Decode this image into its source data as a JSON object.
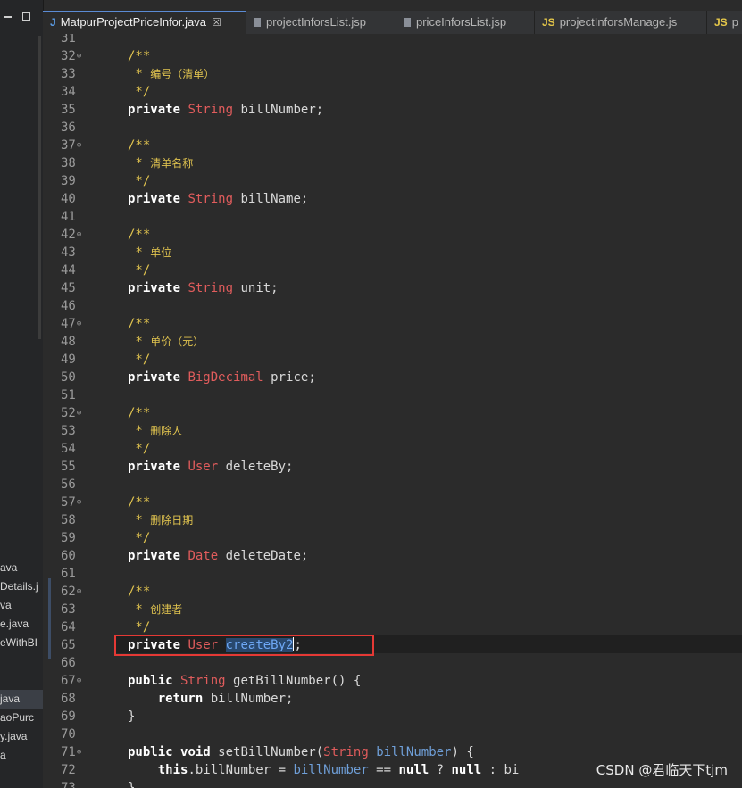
{
  "tabs": [
    {
      "label": "MatpurProjectPriceInfor.java",
      "icon": "java-file-icon",
      "active": true,
      "closable": true
    },
    {
      "label": "projectInforsList.jsp",
      "icon": "jsp-file-icon",
      "active": false
    },
    {
      "label": "priceInforsList.jsp",
      "icon": "jsp-file-icon",
      "active": false
    },
    {
      "label": "projectInforsManage.js",
      "icon": "js-file-icon",
      "active": false
    },
    {
      "label": "p",
      "icon": "js-file-icon",
      "active": false
    }
  ],
  "tab_icon_text": {
    "java": "J",
    "js": "JS",
    "close": "☒"
  },
  "left_panel": {
    "files_top": [
      "ava",
      "Details.j",
      "va",
      "e.java",
      "eWithBI"
    ],
    "files_bottom": [
      "java",
      "aoPurc",
      "y.java",
      "a"
    ],
    "selected_bottom_index": 0
  },
  "code": {
    "lines": [
      {
        "n": "31",
        "fold": false,
        "html": ""
      },
      {
        "n": "32",
        "fold": true,
        "html": "<span class=\"cm\">/**</span>"
      },
      {
        "n": "33",
        "fold": false,
        "html": "<span class=\"cm\"> * <span class=\"cm-zh\">编号（清单）</span></span>"
      },
      {
        "n": "34",
        "fold": false,
        "html": "<span class=\"cm\"> */</span>"
      },
      {
        "n": "35",
        "fold": false,
        "html": "<span class=\"kw\">private</span> <span class=\"ty\">String</span> billNumber;"
      },
      {
        "n": "36",
        "fold": false,
        "html": ""
      },
      {
        "n": "37",
        "fold": true,
        "html": "<span class=\"cm\">/**</span>"
      },
      {
        "n": "38",
        "fold": false,
        "html": "<span class=\"cm\"> * <span class=\"cm-zh\">清单名称</span></span>"
      },
      {
        "n": "39",
        "fold": false,
        "html": "<span class=\"cm\"> */</span>"
      },
      {
        "n": "40",
        "fold": false,
        "html": "<span class=\"kw\">private</span> <span class=\"ty\">String</span> billName;"
      },
      {
        "n": "41",
        "fold": false,
        "html": ""
      },
      {
        "n": "42",
        "fold": true,
        "html": "<span class=\"cm\">/**</span>"
      },
      {
        "n": "43",
        "fold": false,
        "html": "<span class=\"cm\"> * <span class=\"cm-zh\">单位</span></span>"
      },
      {
        "n": "44",
        "fold": false,
        "html": "<span class=\"cm\"> */</span>"
      },
      {
        "n": "45",
        "fold": false,
        "html": "<span class=\"kw\">private</span> <span class=\"ty\">String</span> unit;"
      },
      {
        "n": "46",
        "fold": false,
        "html": ""
      },
      {
        "n": "47",
        "fold": true,
        "html": "<span class=\"cm\">/**</span>"
      },
      {
        "n": "48",
        "fold": false,
        "html": "<span class=\"cm\"> * <span class=\"cm-zh\">单价（元）</span></span>"
      },
      {
        "n": "49",
        "fold": false,
        "html": "<span class=\"cm\"> */</span>"
      },
      {
        "n": "50",
        "fold": false,
        "html": "<span class=\"kw\">private</span> <span class=\"ty\">BigDecimal</span> price;"
      },
      {
        "n": "51",
        "fold": false,
        "html": ""
      },
      {
        "n": "52",
        "fold": true,
        "html": "<span class=\"cm\">/**</span>"
      },
      {
        "n": "53",
        "fold": false,
        "html": "<span class=\"cm\"> * <span class=\"cm-zh\">删除人</span></span>"
      },
      {
        "n": "54",
        "fold": false,
        "html": "<span class=\"cm\"> */</span>"
      },
      {
        "n": "55",
        "fold": false,
        "html": "<span class=\"kw\">private</span> <span class=\"ty\">User</span> deleteBy;"
      },
      {
        "n": "56",
        "fold": false,
        "html": ""
      },
      {
        "n": "57",
        "fold": true,
        "html": "<span class=\"cm\">/**</span>"
      },
      {
        "n": "58",
        "fold": false,
        "html": "<span class=\"cm\"> * <span class=\"cm-zh\">删除日期</span></span>"
      },
      {
        "n": "59",
        "fold": false,
        "html": "<span class=\"cm\"> */</span>"
      },
      {
        "n": "60",
        "fold": false,
        "html": "<span class=\"kw\">private</span> <span class=\"ty\">Date</span> deleteDate;"
      },
      {
        "n": "61",
        "fold": false,
        "html": ""
      },
      {
        "n": "62",
        "fold": true,
        "html": "<span class=\"cm\">/**</span>"
      },
      {
        "n": "63",
        "fold": false,
        "html": "<span class=\"cm\"> * <span class=\"cm-zh\">创建者</span></span>"
      },
      {
        "n": "64",
        "fold": false,
        "html": "<span class=\"cm\"> */</span>"
      },
      {
        "n": "65",
        "fold": false,
        "html": "<span class=\"kw\">private</span> <span class=\"ty\">User</span> <span class=\"sel-txt\">createBy2</span><span class=\"caret\"></span>;"
      },
      {
        "n": "66",
        "fold": false,
        "html": ""
      },
      {
        "n": "67",
        "fold": true,
        "html": "<span class=\"kw\">public</span> <span class=\"ty\">String</span> getBillNumber() {"
      },
      {
        "n": "68",
        "fold": false,
        "html": "    <span class=\"kw\">return</span> billNumber;"
      },
      {
        "n": "69",
        "fold": false,
        "html": "}"
      },
      {
        "n": "70",
        "fold": false,
        "html": ""
      },
      {
        "n": "71",
        "fold": true,
        "html": "<span class=\"kw\">public</span> <span class=\"kw\">void</span> setBillNumber(<span class=\"ty\">String</span> <span class=\"param\">billNumber</span>) {"
      },
      {
        "n": "72",
        "fold": false,
        "html": "    <span class=\"kw\">this</span>.billNumber = <span class=\"param\">billNumber</span> == <span class=\"kw\">null</span> ? <span class=\"kw\">null</span> : bi"
      },
      {
        "n": "73",
        "fold": false,
        "html": "}"
      }
    ]
  },
  "watermark": "CSDN @君临天下tjm",
  "colors": {
    "accent": "#5b8bd4",
    "highlight_box": "#e53935",
    "keyword": "#ffffff",
    "type": "#e05c5c",
    "comment": "#e0c34f"
  }
}
